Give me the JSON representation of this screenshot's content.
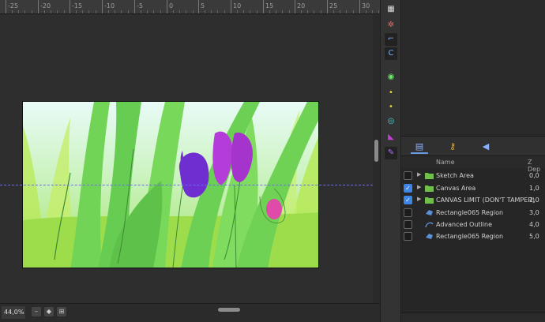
{
  "ruler": {
    "labels": [
      "-25",
      "-20",
      "-15",
      "-10",
      "-5",
      "0",
      "5",
      "10",
      "15",
      "20",
      "25",
      "30"
    ]
  },
  "status_bar": {
    "zoom": "44,0%"
  },
  "layers_panel": {
    "tabs": [
      "layers-icon",
      "key-icon",
      "sound-icon"
    ],
    "columns": {
      "name": "Name",
      "z_depth": "Z Dep"
    },
    "rows": [
      {
        "name": "Sketch Area",
        "z": "0,0",
        "visible": false,
        "type": "folder",
        "expandable": true
      },
      {
        "name": "Canvas Area",
        "z": "1,0",
        "visible": true,
        "type": "folder",
        "expandable": true
      },
      {
        "name": "CANVAS LIMIT (DON'T TAMPER)",
        "z": "2,0",
        "visible": true,
        "type": "folder",
        "expandable": true
      },
      {
        "name": "Rectangle065 Region",
        "z": "3,0",
        "visible": false,
        "type": "region",
        "expandable": false
      },
      {
        "name": "Advanced Outline",
        "z": "4,0",
        "visible": false,
        "type": "outline",
        "expandable": false
      },
      {
        "name": "Rectangle065 Region",
        "z": "5,0",
        "visible": false,
        "type": "region",
        "expandable": false
      }
    ]
  },
  "toolbar": {
    "tools": [
      "grid-icon",
      "transform-icon",
      "bone-icon",
      "curve-icon",
      "circle-tool-icon",
      "point-tool-icon",
      "point-tool-2-icon",
      "width-icon",
      "fill-icon",
      "pen-icon"
    ]
  },
  "colors": {
    "accent": "#3b86e6",
    "guide": "#6c6cf0",
    "grass_light": "#8fe05a",
    "grass_dark": "#5ec14a",
    "tulip_purple": "#6f2fd0",
    "tulip_magenta": "#b43cd8",
    "flower_pink": "#e04aa8"
  }
}
